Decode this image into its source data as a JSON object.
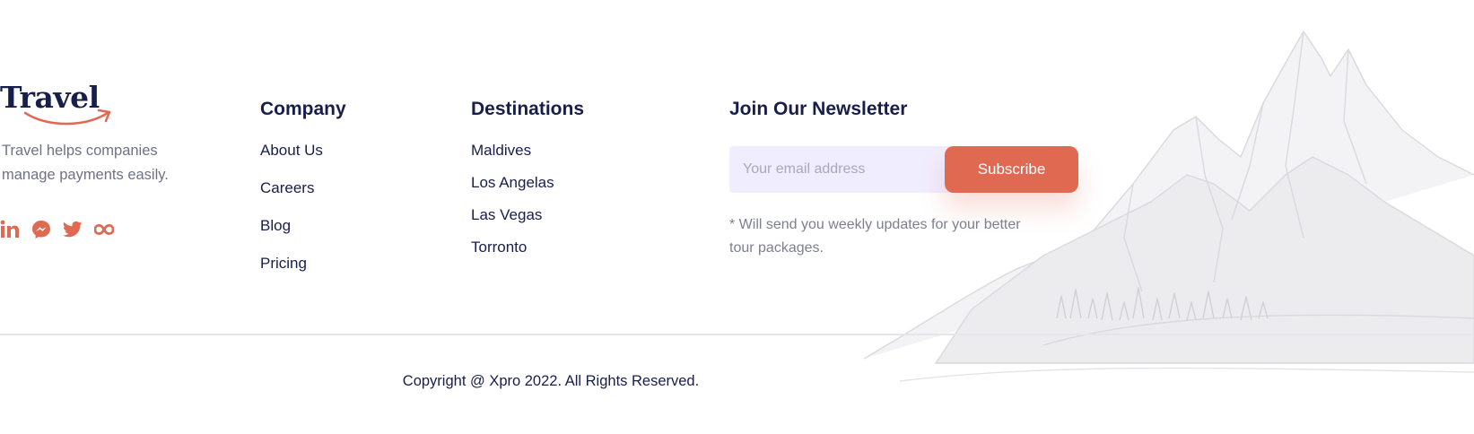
{
  "brand": {
    "logo": "Travel",
    "tagline": "Travel helps companies manage payments easily.",
    "socials": [
      {
        "icon": "linkedin-icon"
      },
      {
        "icon": "messenger-icon"
      },
      {
        "icon": "twitter-icon"
      },
      {
        "icon": "infinity-icon"
      }
    ]
  },
  "company": {
    "title": "Company",
    "links": [
      "About Us",
      "Careers",
      "Blog",
      "Pricing"
    ]
  },
  "destinations": {
    "title": "Destinations",
    "links": [
      "Maldives",
      "Los Angelas",
      "Las Vegas",
      "Torronto"
    ]
  },
  "newsletter": {
    "title": "Join Our Newsletter",
    "placeholder": "Your email address",
    "button": "Subscribe",
    "note": "*  Will send you weekly updates for your better tour packages."
  },
  "footer": {
    "copyright": "Copyright @ Xpro 2022. All Rights Reserved."
  },
  "colors": {
    "accent": "#df6951",
    "heading": "#181e4b",
    "muted": "#6f7285",
    "input_bg": "#f0edff"
  }
}
